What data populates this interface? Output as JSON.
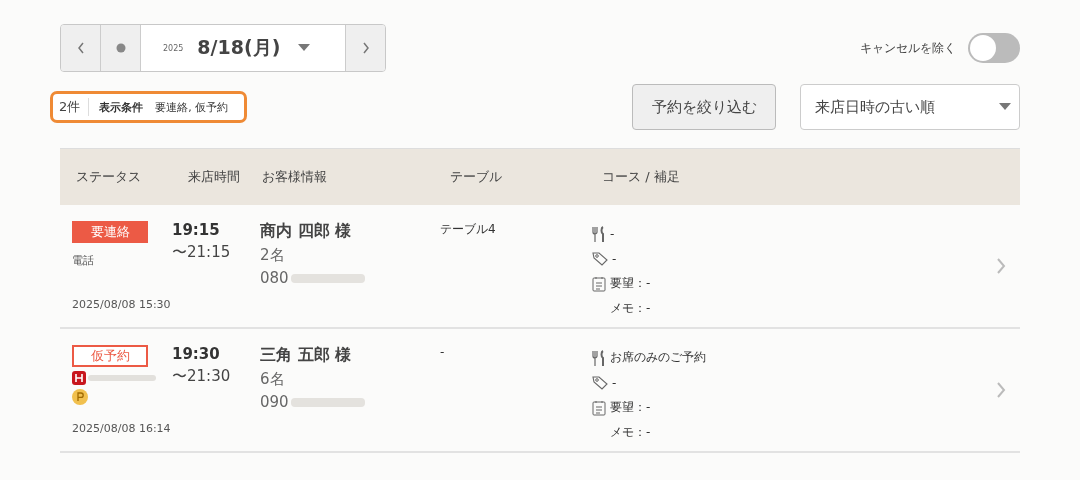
{
  "date_nav": {
    "year": "2025",
    "date": "8/18(月)"
  },
  "cancel_toggle": {
    "label": "キャンセルを除く",
    "on": false
  },
  "filter_summary": {
    "count": "2件",
    "label": "表示条件",
    "value": "要連絡, 仮予約"
  },
  "filter_button": "予約を絞り込む",
  "sort_select": {
    "value": "来店日時の古い順"
  },
  "table": {
    "columns": [
      "ステータス",
      "来店時間",
      "お客様情報",
      "テーブル",
      "コース / 補足"
    ],
    "rows": [
      {
        "status": {
          "label": "要連絡",
          "kind": "filled"
        },
        "sources": [
          {
            "kind": "text",
            "text": "電話"
          }
        ],
        "created": "2025/08/08 15:30",
        "start": "19:15",
        "end": "〜21:15",
        "name": "商内 四郎 様",
        "party": "2名",
        "phone": "080",
        "table": "テーブル4",
        "course": "-",
        "coupon": "-",
        "request": "要望：-",
        "memo": "メモ：-"
      },
      {
        "status": {
          "label": "仮予約",
          "kind": "outline"
        },
        "sources": [
          {
            "kind": "h-badge"
          },
          {
            "kind": "p-badge"
          }
        ],
        "created": "2025/08/08 16:14",
        "start": "19:30",
        "end": "〜21:30",
        "name": "三角 五郎 様",
        "party": "6名",
        "phone": "090",
        "table": "-",
        "course": "お席のみのご予約",
        "coupon": "-",
        "request": "要望：-",
        "memo": "メモ：-"
      }
    ]
  }
}
